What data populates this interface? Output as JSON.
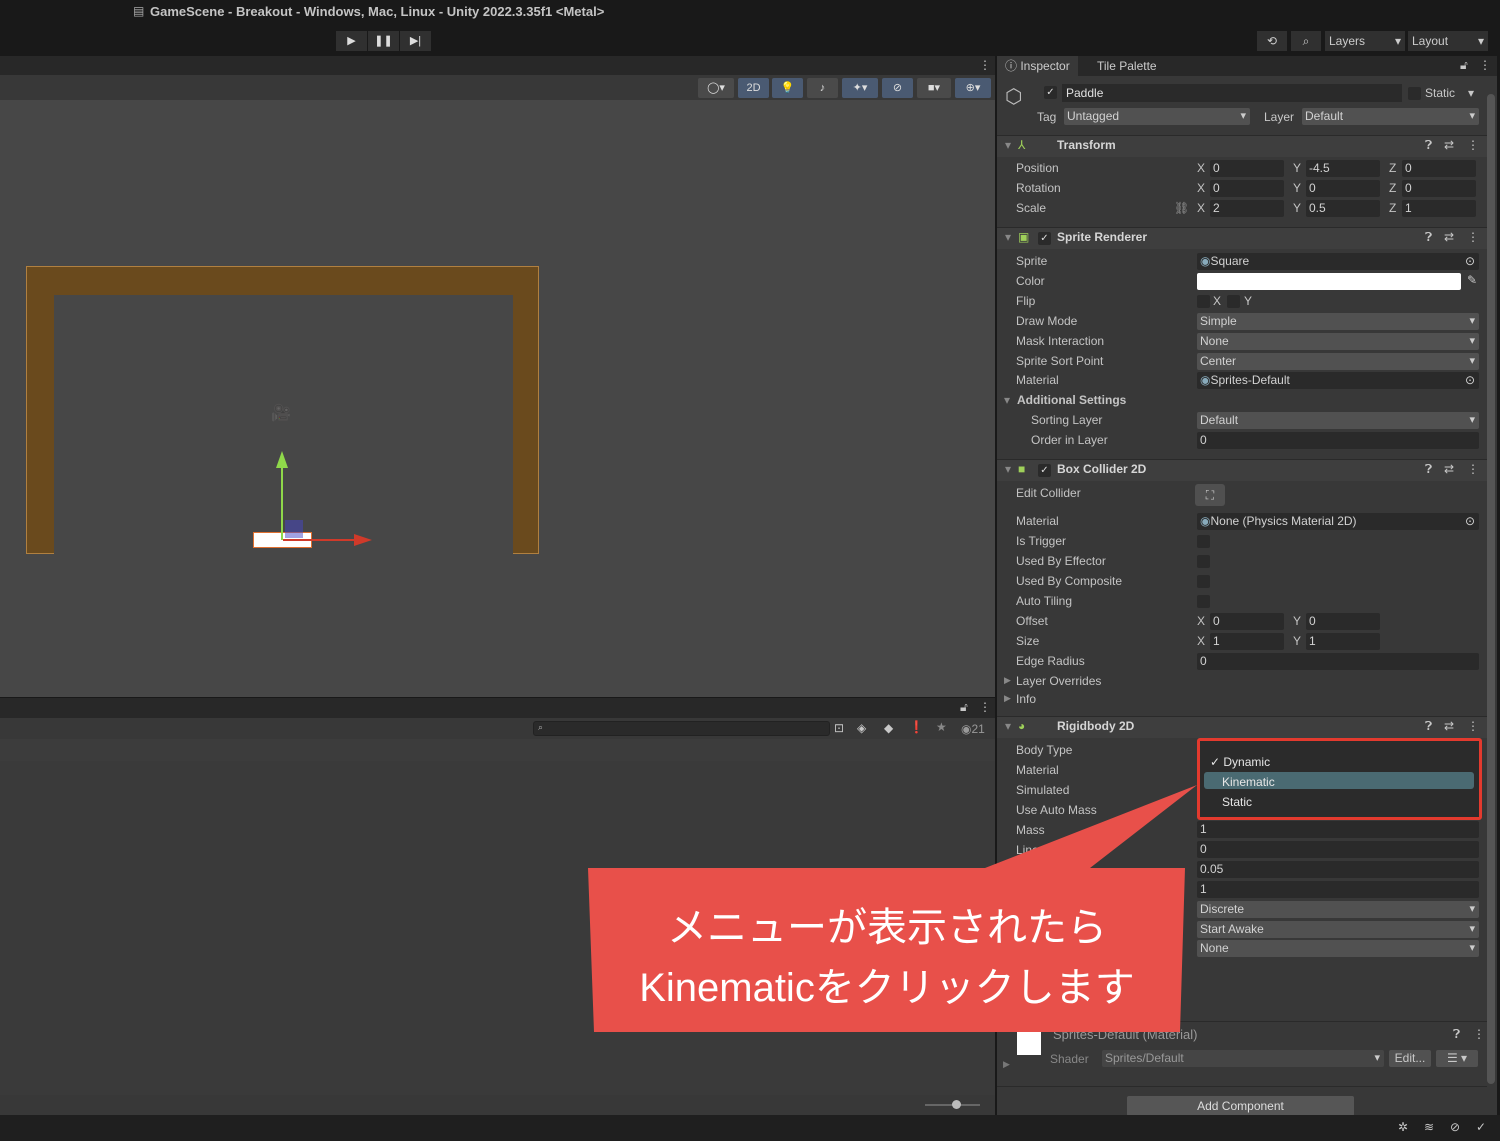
{
  "window": {
    "title": "GameScene - Breakout - Windows, Mac, Linux - Unity 2022.3.35f1 <Metal>"
  },
  "toolbar": {
    "play": "▶",
    "pause": "❚❚",
    "step": "▶|",
    "history_icon": "history-icon",
    "search_icon": "search-icon",
    "layers": "Layers",
    "layout": "Layout"
  },
  "scene_toolbar": {
    "mode_2d": "2D"
  },
  "bottom_panel": {
    "visible_count": "21"
  },
  "inspector": {
    "tabs": [
      "Inspector",
      "Tile Palette"
    ],
    "object": {
      "name": "Paddle",
      "static_label": "Static",
      "tag_label": "Tag",
      "tag": "Untagged",
      "layer_label": "Layer",
      "layer": "Default"
    },
    "transform": {
      "title": "Transform",
      "rows": [
        {
          "label": "Position",
          "x": "0",
          "y": "-4.5",
          "z": "0"
        },
        {
          "label": "Rotation",
          "x": "0",
          "y": "0",
          "z": "0"
        },
        {
          "label": "Scale",
          "x": "2",
          "y": "0.5",
          "z": "1"
        }
      ]
    },
    "sprite_renderer": {
      "title": "Sprite Renderer",
      "rows": [
        {
          "label": "Sprite",
          "value": "Square",
          "kind": "obj"
        },
        {
          "label": "Color",
          "value": "",
          "kind": "color"
        },
        {
          "label": "Flip",
          "value": "",
          "kind": "flip"
        },
        {
          "label": "Draw Mode",
          "value": "Simple",
          "kind": "dd"
        },
        {
          "label": "Mask Interaction",
          "value": "None",
          "kind": "dd"
        },
        {
          "label": "Sprite Sort Point",
          "value": "Center",
          "kind": "dd"
        },
        {
          "label": "Material",
          "value": "Sprites-Default",
          "kind": "obj"
        },
        {
          "label": "Additional Settings",
          "value": "",
          "kind": "fold"
        },
        {
          "label": "Sorting Layer",
          "value": "Default",
          "kind": "dd",
          "indent": true
        },
        {
          "label": "Order in Layer",
          "value": "0",
          "kind": "text",
          "indent": true
        }
      ]
    },
    "box_collider": {
      "title": "Box Collider 2D",
      "edit_collider": "Edit Collider",
      "rows": [
        {
          "label": "Material",
          "value": "None (Physics Material 2D)",
          "kind": "obj"
        },
        {
          "label": "Is Trigger",
          "kind": "chk"
        },
        {
          "label": "Used By Effector",
          "kind": "chk"
        },
        {
          "label": "Used By Composite",
          "kind": "chk"
        },
        {
          "label": "Auto Tiling",
          "kind": "chk"
        },
        {
          "label": "Offset",
          "kind": "xy",
          "x": "0",
          "y": "0"
        },
        {
          "label": "Size",
          "kind": "xy",
          "x": "1",
          "y": "1"
        },
        {
          "label": "Edge Radius",
          "value": "0",
          "kind": "text"
        },
        {
          "label": "Layer Overrides",
          "kind": "foldc"
        },
        {
          "label": "Info",
          "kind": "foldc"
        }
      ]
    },
    "rigidbody": {
      "title": "Rigidbody 2D",
      "labels": [
        "Body Type",
        "Material",
        "Simulated",
        "Use Auto Mass",
        "Mass",
        "Linear Drag"
      ],
      "values": [
        {
          "value": "1",
          "kind": "text"
        },
        {
          "value": "0",
          "kind": "text"
        },
        {
          "value": "0.05",
          "kind": "text"
        },
        {
          "value": "1",
          "kind": "text"
        },
        {
          "value": "Discrete",
          "kind": "dd"
        },
        {
          "value": "Start Awake",
          "kind": "dd"
        },
        {
          "value": "None",
          "kind": "dd"
        }
      ],
      "body_type_menu": {
        "options": [
          "Dynamic",
          "Kinematic",
          "Static"
        ],
        "checked": "Dynamic",
        "highlighted": "Kinematic"
      }
    },
    "material": {
      "title": "Sprites-Default (Material)",
      "shader_label": "Shader",
      "shader": "Sprites/Default",
      "edit": "Edit..."
    },
    "add_component": "Add Component"
  },
  "callout": {
    "line1": "メニューが表示されたら",
    "line2": "Kinematicをクリックします",
    "color": "#e8504a"
  },
  "colors": {
    "highlight": "#4a6a72",
    "popup_border": "#e33a2e",
    "frame": "#6a4a1d"
  }
}
